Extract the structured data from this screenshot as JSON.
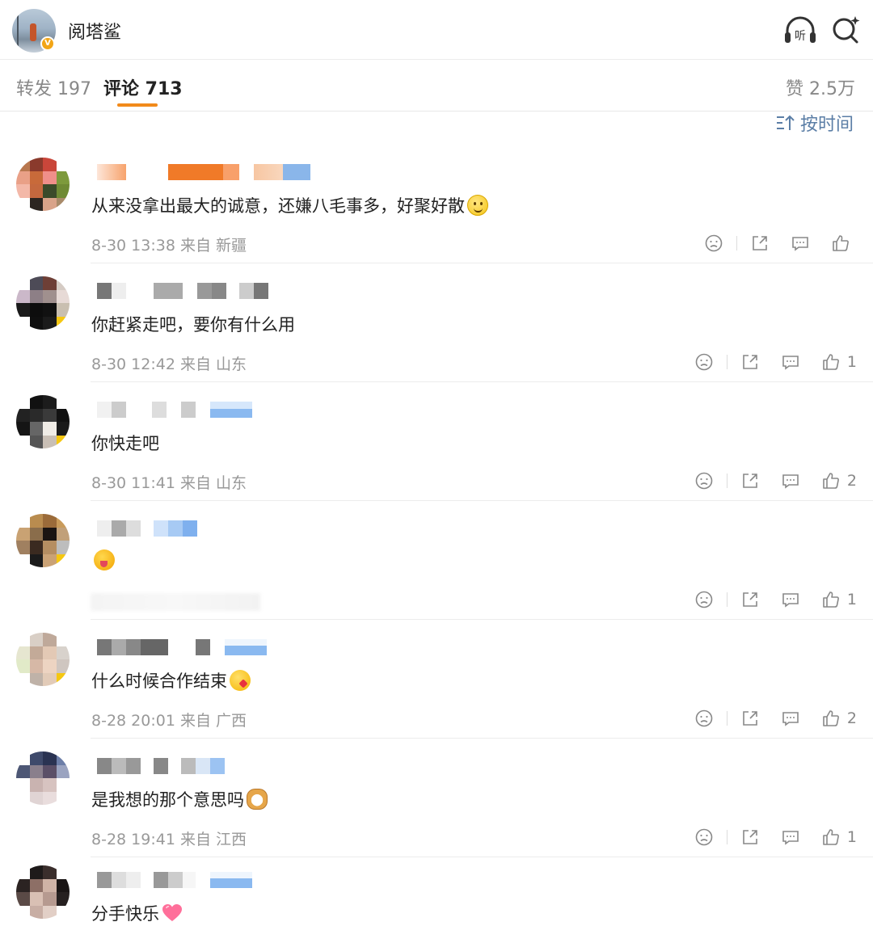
{
  "header": {
    "account_name": "阅塔鲨",
    "verified_badge": "V",
    "icons": [
      "listen-icon",
      "search-ai-icon"
    ]
  },
  "tabs": {
    "repost": "转发 197",
    "comments": "评论 713",
    "likes": "赞 2.5万",
    "accent_color": "#f28a1a"
  },
  "sort": {
    "label": "按时间",
    "link_color": "#5b7ea6"
  },
  "comments": [
    {
      "text": "从来没拿出最大的诚意，还嫌八毛事多，好聚好散",
      "emoji": "smile-emoji",
      "time": "8-30 13:38",
      "source": "来自 新疆",
      "likes": ""
    },
    {
      "text": "你赶紧走吧，要你有什么用",
      "emoji": "",
      "time": "8-30 12:42",
      "source": "来自 山东",
      "likes": "1"
    },
    {
      "text": "你快走吧",
      "emoji": "",
      "time": "8-30 11:41",
      "source": "来自 山东",
      "likes": "2"
    },
    {
      "text": "",
      "emoji": "tongue-out-emoji",
      "time": "",
      "source": "",
      "likes": "1"
    },
    {
      "text": "什么时候合作结束",
      "emoji": "kiss-emoji",
      "time": "8-28 20:01",
      "source": "来自 广西",
      "likes": "2"
    },
    {
      "text": "是我想的那个意思吗",
      "emoji": "cat-emoji",
      "time": "8-28 19:41",
      "source": "来自 江西",
      "likes": "1"
    },
    {
      "text": "分手快乐",
      "emoji": "heart-emoji",
      "time": "",
      "source": "",
      "likes": ""
    }
  ]
}
